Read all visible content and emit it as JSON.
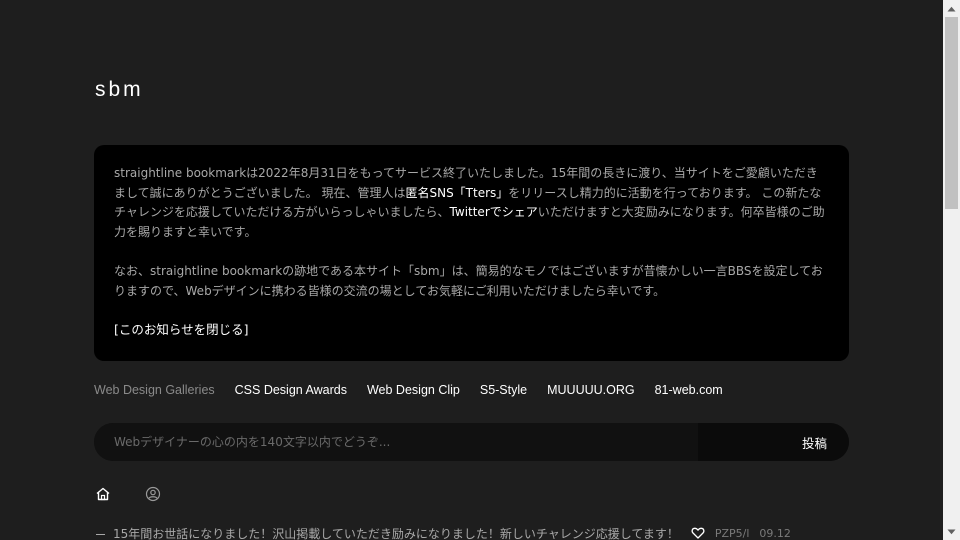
{
  "site": {
    "logo": "sbm"
  },
  "notice": {
    "p1_a": "straightline bookmarkは2022年8月31日をもってサービス終了いたしました。15年間の長きに渡り、当サイトをご愛顧いただきまして誠にありがとうございました。 現在、管理人は",
    "p1_link1": "匿名SNS「Tters」",
    "p1_b": "をリリースし精力的に活動を行っております。 この新たなチャレンジを応援していただける方がいらっしゃいましたら、",
    "p1_link2": "Twitterでシェア",
    "p1_c": "いただけますと大変励みになります。何卒皆様のご助力を賜りますと幸いです。",
    "p2": "なお、straightline bookmarkの跡地である本サイト「sbm」は、簡易的なモノではございますが昔懐かしい一言BBSを設定しておりますので、Webデザインに携わる皆様の交流の場としてお気軽にご利用いただけましたら幸いです。",
    "close": "[このお知らせを閉じる]"
  },
  "nav": {
    "items": [
      {
        "label": "Web Design Galleries"
      },
      {
        "label": "CSS Design Awards"
      },
      {
        "label": "Web Design Clip"
      },
      {
        "label": "S5-Style"
      },
      {
        "label": "MUUUUU.ORG"
      },
      {
        "label": "81-web.com"
      }
    ]
  },
  "post": {
    "placeholder": "Webデザイナーの心の内を140文字以内でどうぞ...",
    "value": "",
    "submit": "投稿"
  },
  "tabs": {
    "icons": [
      "home-icon",
      "user-icon"
    ]
  },
  "entries": [
    {
      "text": "15年間お世話になりました！沢山掲載していただき励みになりました！新しいチャレンジ応援してます！",
      "user": "PZP5/l",
      "date": "09.12"
    }
  ],
  "colors": {
    "background": "#1e1e1e",
    "panel": "#000000",
    "text": "#a8a8a8",
    "highlight": "#ffffff"
  }
}
